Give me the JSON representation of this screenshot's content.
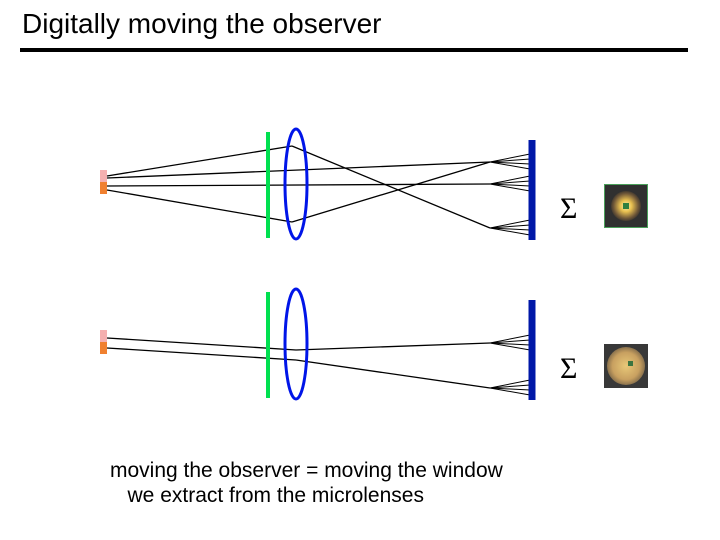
{
  "title": "Digitally moving the observer",
  "sigma": "Σ",
  "caption_line1": "moving the observer  =  moving the window",
  "caption_line2": "we extract from the microlenses",
  "colors": {
    "lens_green": "#00e050",
    "lens_blue": "#0015e8",
    "sensor_blue": "#0018a8",
    "ray_black": "#000000",
    "src_pink": "#f5b0b0",
    "src_orange": "#f08030"
  }
}
